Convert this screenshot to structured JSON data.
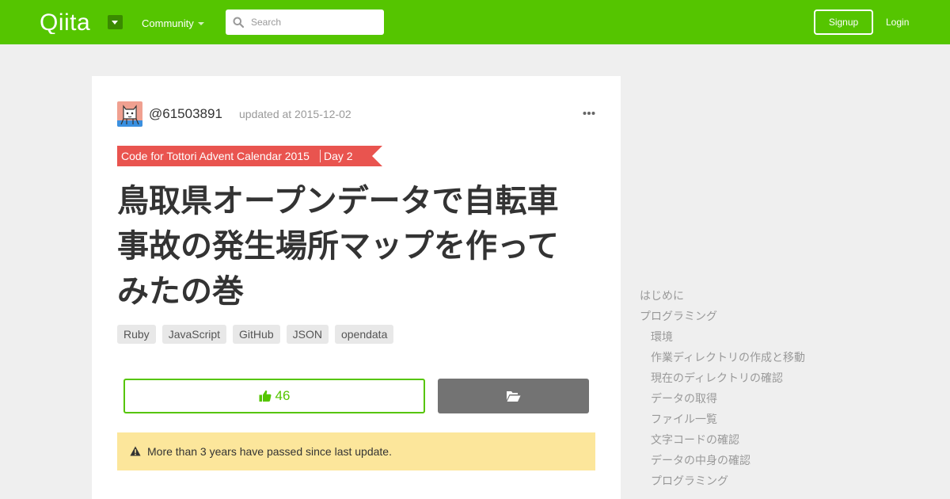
{
  "header": {
    "logo_text": "Qiita",
    "community_label": "Community",
    "search_placeholder": "Search",
    "signup_label": "Signup",
    "login_label": "Login",
    "brand_color": "#55c500"
  },
  "article": {
    "username": "@61503891",
    "updated": "updated at 2015-12-02",
    "calendar": {
      "name": "Code for Tottori Advent Calendar 2015",
      "day": "Day 2",
      "color": "#e9544f"
    },
    "title": "鳥取県オープンデータで自転車事故の発生場所マップを作ってみたの巻",
    "tags": [
      "Ruby",
      "JavaScript",
      "GitHub",
      "JSON",
      "opendata"
    ],
    "likes": "46",
    "alert": "More than 3 years have passed since last update."
  },
  "toc": {
    "items": [
      {
        "label": "はじめに",
        "level": 1
      },
      {
        "label": "プログラミング",
        "level": 1
      },
      {
        "label": "環境",
        "level": 2
      },
      {
        "label": "作業ディレクトリの作成と移動",
        "level": 2
      },
      {
        "label": "現在のディレクトリの確認",
        "level": 2
      },
      {
        "label": "データの取得",
        "level": 2
      },
      {
        "label": "ファイル一覧",
        "level": 2
      },
      {
        "label": "文字コードの確認",
        "level": 2
      },
      {
        "label": "データの中身の確認",
        "level": 2
      },
      {
        "label": "プログラミング",
        "level": 2
      }
    ]
  }
}
